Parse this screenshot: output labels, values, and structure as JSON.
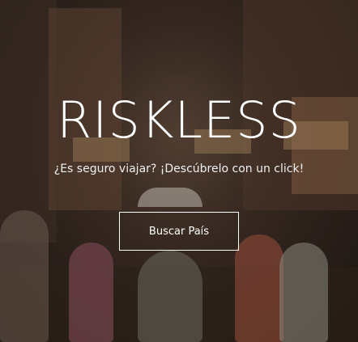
{
  "hero": {
    "title": "RISKLESS",
    "subtitle": "¿Es seguro viajar? ¡Descúbrelo con un click!",
    "button_label": "Buscar País"
  }
}
